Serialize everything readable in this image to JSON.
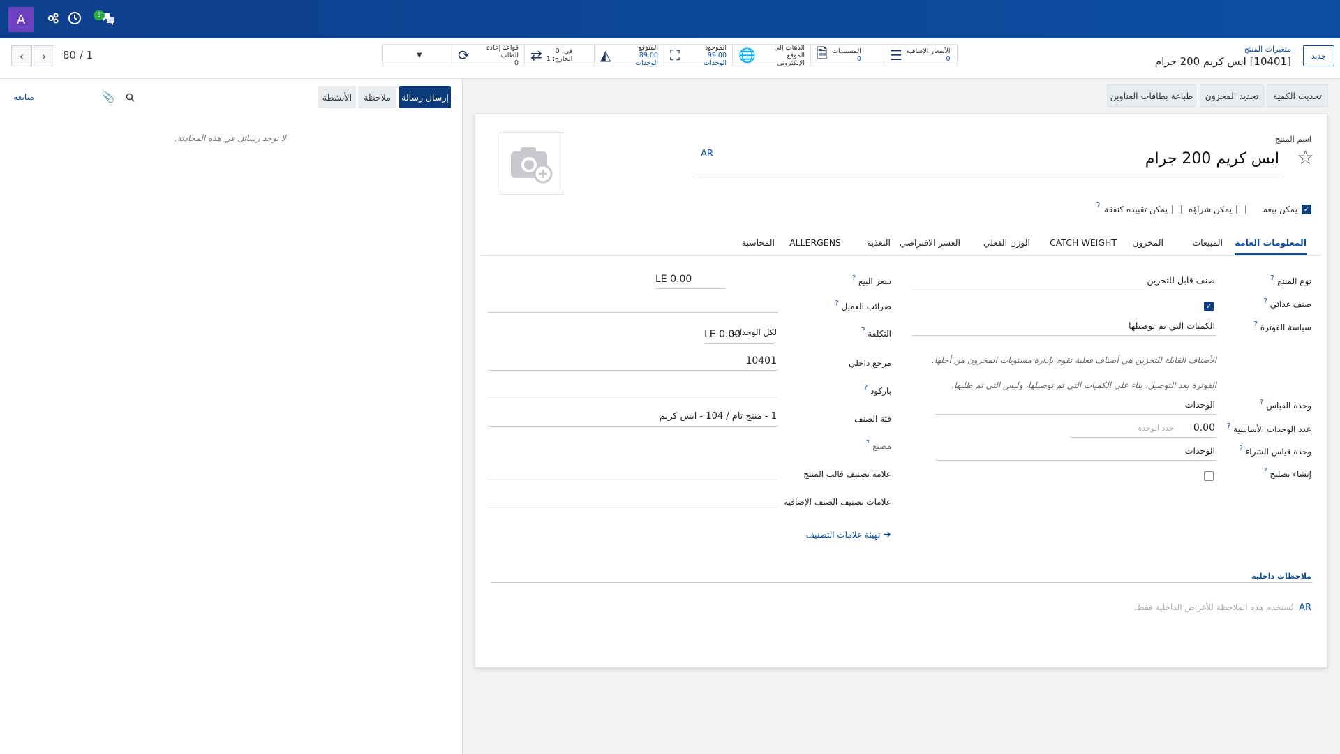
{
  "topbar": {
    "avatar_letter": "A",
    "icons": [
      "activities-icon",
      "clock-icon",
      "discuss-icon"
    ],
    "message_count": "5"
  },
  "pager": {
    "value": "80 / 1"
  },
  "breadcrumb": {
    "parent": "متغيرات المنتج",
    "current": "[10401] ايس كريم 200 جرام"
  },
  "new_button": "جديد",
  "stats": [
    {
      "name": "extra-prices",
      "icon": "list-icon",
      "label": "الأسعار الإضافية",
      "value": "0"
    },
    {
      "name": "documents",
      "icon": "document-icon",
      "label": "المستندات",
      "value": "0"
    },
    {
      "name": "website",
      "icon": "globe-icon",
      "label": "الذهاب إلى",
      "value": "الموقع الإلكتروني"
    },
    {
      "name": "on-hand",
      "icon": "cubes-icon",
      "label": "الموجود",
      "value": "99.00 الوحدات"
    },
    {
      "name": "forecasted",
      "icon": "area-chart-icon",
      "label": "المتوقع",
      "value": "89.00 الوحدات"
    },
    {
      "name": "in-out",
      "icon": "exchange-icon",
      "label": "في: 0",
      "value": "الخارج: 1"
    },
    {
      "name": "reordering",
      "icon": "refresh-icon",
      "label": "قواعد إعادة الطلب",
      "value": "0"
    }
  ],
  "actions": {
    "update_qty": "تحديث الكمية",
    "replenish": "تجديد المخزون",
    "print_labels": "طباعة بطاقات العناوين"
  },
  "form": {
    "name_label": "اسم المنتج",
    "name": "ايس كريم 200 جرام",
    "lang": "AR",
    "can_be_sold": "يمكن بيعه",
    "can_be_purchased": "يمكن شراؤه",
    "can_be_expensed": "يمكن تقييده كنفقة",
    "tabs": [
      "المعلومات العامة",
      "المبيعات",
      "المخزون",
      "CATCH WEIGHT",
      "الوزن الفعلي",
      "العسر الافتراضي",
      "التغذية",
      "ALLERGENS",
      "المحاسبة"
    ],
    "left": {
      "product_type_label": "نوع المنتج",
      "product_type": "صنف قابل للتخزين",
      "food_item_label": "صنف غذائي",
      "invoice_policy_label": "سياسة الفوترة",
      "invoice_policy": "الكميات التي تم توصيلها",
      "note1": "الأصناف القابلة للتخزين هي أصناف فعلية تقوم بإدارة مستويات المخزون من أجلها.",
      "note2": "الفوترة بعد التوصيل، بناء على الكميات التي تم توصيلها، وليس التي تم طلبها.",
      "uom_label": "وحدة القياس",
      "uom": "الوحدات",
      "base_units_label": "عدد الوحدات الأساسية",
      "base_units": "0.00",
      "unit_placeholder": "حدد الوحدة",
      "purchase_uom_label": "وحدة قياس الشراء",
      "purchase_uom": "الوحدات",
      "create_repair_label": "إنشاء تصليح"
    },
    "right": {
      "sales_price_label": "سعر البيع",
      "sales_price": "LE 0.00",
      "customer_taxes_label": "ضرائب العميل",
      "cost_label": "التكلفة",
      "cost": "LE 0.00",
      "cost_unit": "لكل الوحدات",
      "internal_ref_label": "مرجع داخلي",
      "internal_ref": "10401",
      "barcode_label": "باركود",
      "category_label": "فئة الصنف",
      "category": "1 - منتج تام / 104 - ايس كريم",
      "manufacturer_label": "مصنع",
      "template_tags_label": "علامة تصنيف قالب المنتج",
      "extra_tags_label": "علامات تصنيف الصنف الإضافية",
      "configure_tags": "تهيئة علامات التصنيف"
    },
    "notes_title": "ملاحظات داخلية",
    "notes_lang": "AR",
    "notes_placeholder": "تُستخدم هذه الملاحظة للأغراض الداخلية فقط."
  },
  "chatter": {
    "send_message": "إرسال رسالة",
    "log_note": "ملاحظة",
    "activities": "الأنشطة",
    "follow": "متابعة",
    "empty": "لا توجد رسائل في هذه المحادثة."
  }
}
